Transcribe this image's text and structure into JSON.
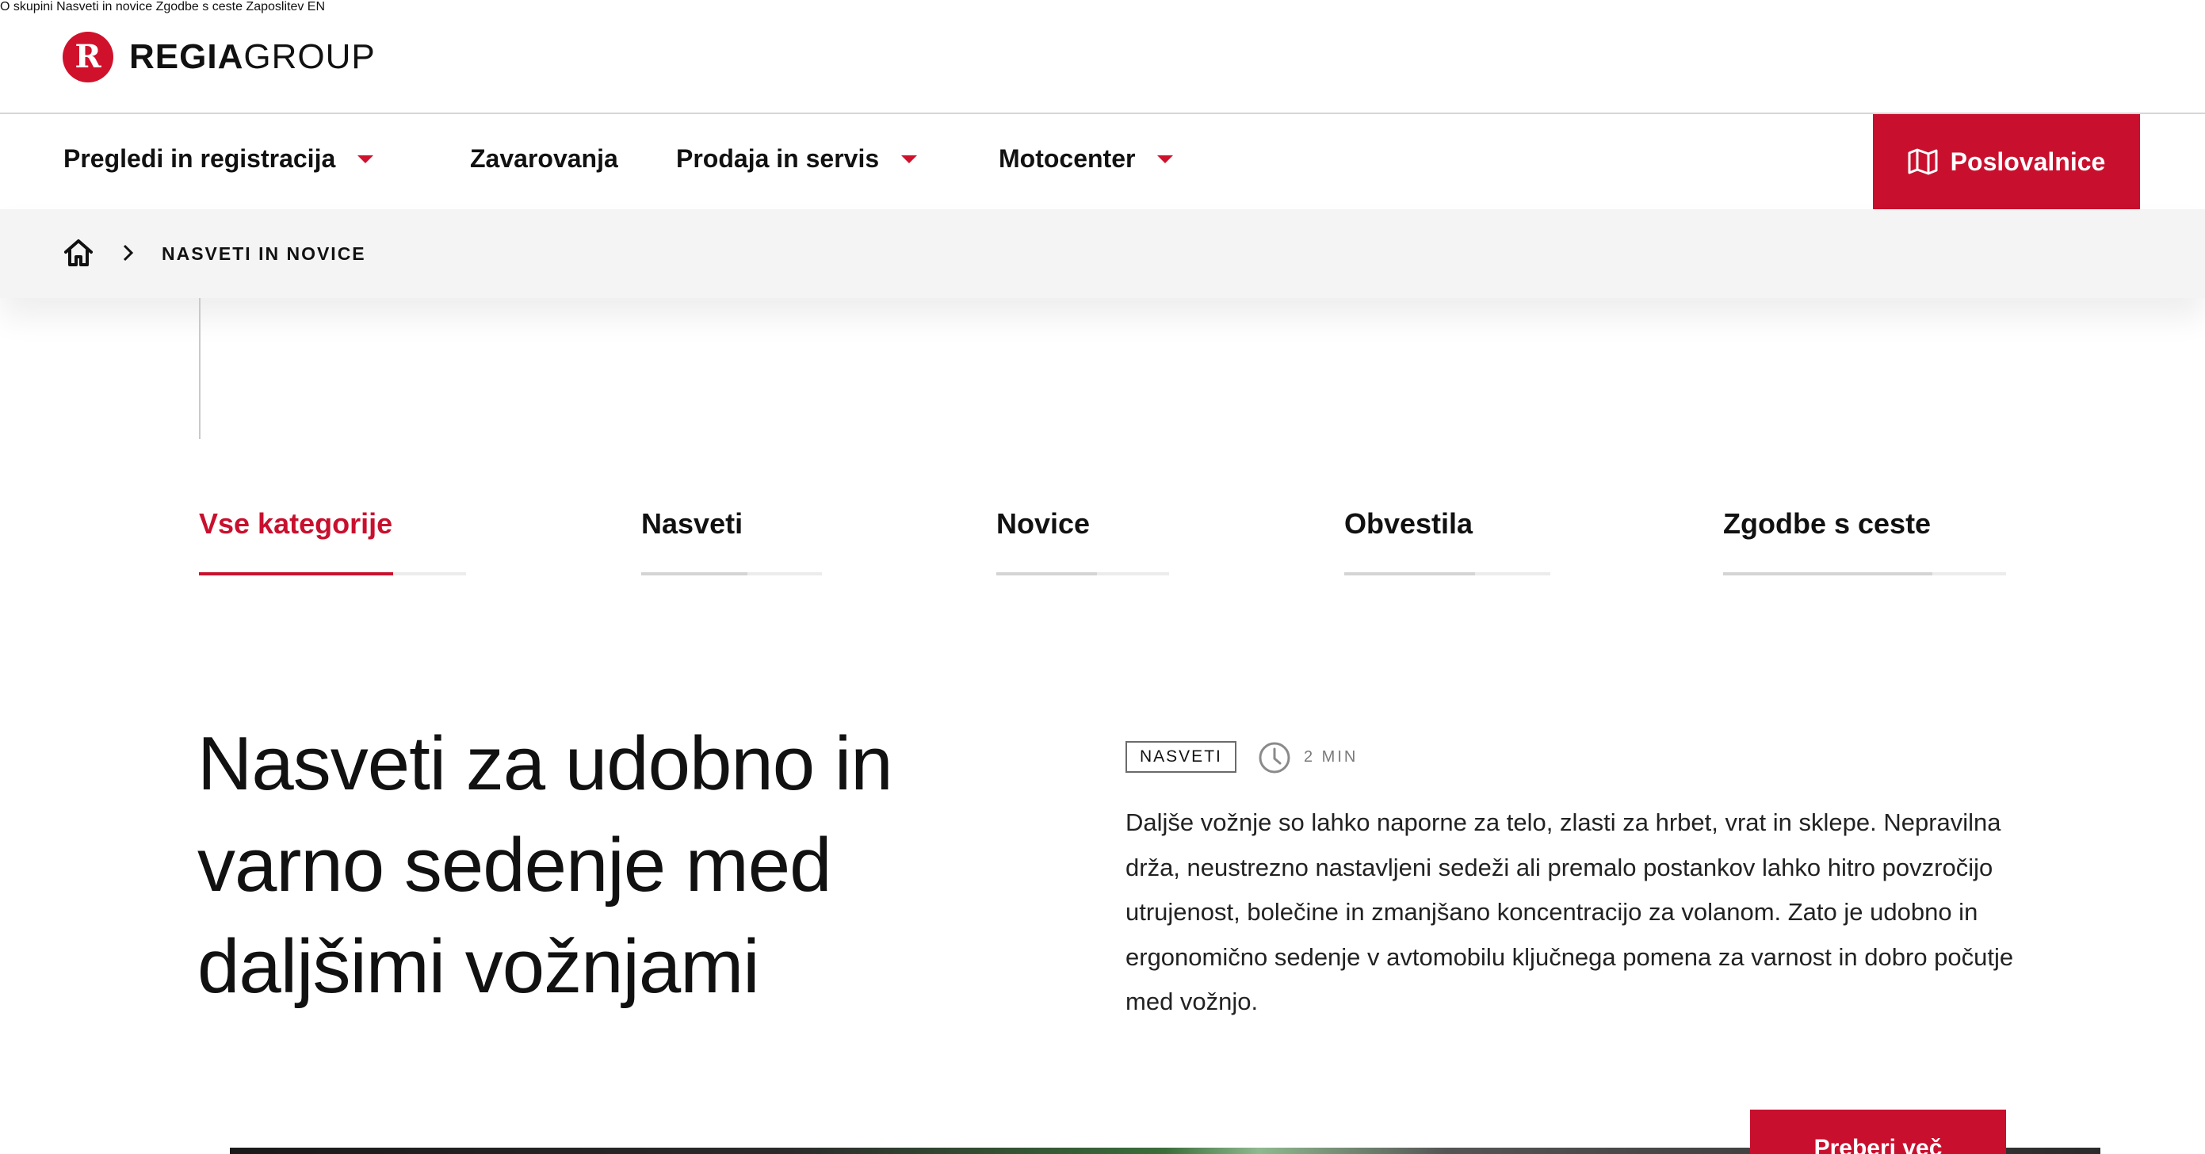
{
  "brand": {
    "mark": "R",
    "name_bold": "REGIA",
    "name_light": "GROUP",
    "accent": "#c8102e"
  },
  "top_nav": [
    "O skupini",
    "Nasveti in novice",
    "Zgodbe s ceste",
    "Zaposlitev",
    "EN"
  ],
  "main_nav": {
    "items": [
      {
        "label": "Pregledi in registracija",
        "dropdown": true
      },
      {
        "label": "Zavarovanja",
        "dropdown": false
      },
      {
        "label": "Prodaja in servis",
        "dropdown": true
      },
      {
        "label": "Motocenter",
        "dropdown": true
      }
    ],
    "branches_label": "Poslovalnice",
    "branches_icon": "map-icon"
  },
  "breadcrumb": {
    "home_icon": "home-icon",
    "separator_icon": "chevron-right-icon",
    "current": "NASVETI IN NOVICE"
  },
  "tabs": [
    {
      "label": "Vse kategorije",
      "active": true
    },
    {
      "label": "Nasveti",
      "active": false
    },
    {
      "label": "Novice",
      "active": false
    },
    {
      "label": "Obvestila",
      "active": false
    },
    {
      "label": "Zgodbe s ceste",
      "active": false
    }
  ],
  "article": {
    "title": "Nasveti za udobno in varno sedenje med daljšimi vožnjami",
    "tag": "NASVETI",
    "read_time": "2 MIN",
    "clock_icon": "clock-icon",
    "excerpt": "Daljše vožnje so lahko naporne za telo, zlasti za hrbet, vrat in sklepe. Nepravilna drža, neustrezno nastavljeni sedeži ali premalo postankov lahko hitro povzročijo utrujenost, bolečine in zmanjšano koncentracijo za volanom. Zato je udobno in ergonomično sedenje v avtomobilu ključnega pomena za varnost in dobro počutje med vožnjo.",
    "read_more": "Preberi več"
  }
}
